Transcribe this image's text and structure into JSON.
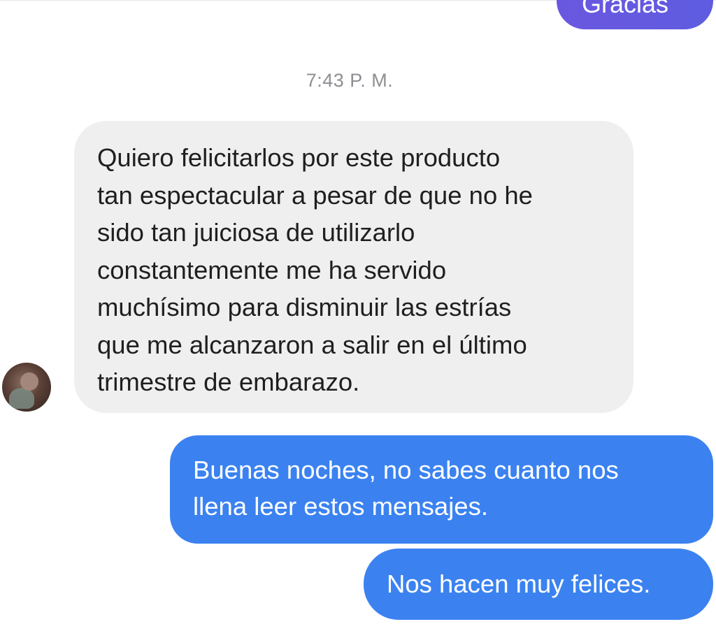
{
  "colors": {
    "background": "#ffffff",
    "incoming_bubble": "#efefef",
    "outgoing_bubble": "#3b82f0",
    "previous_outgoing_bubble": "#6a57e0",
    "timestamp_text": "#8e8e93"
  },
  "conversation": {
    "previous_outgoing": {
      "partial_text": "Gracias"
    },
    "timestamp": "7:43 P. M.",
    "incoming_message": {
      "avatar_icon": "user-avatar",
      "lines": [
        "Quiero felicitarlos por este producto",
        "tan espectacular a pesar de que no he",
        "sido tan juiciosa de utilizarlo",
        "constantemente me ha servido",
        "muchísimo para disminuir las estrías",
        "que me alcanzaron a salir en el último",
        "trimestre de embarazo."
      ]
    },
    "outgoing_messages": [
      {
        "lines": [
          "Buenas noches, no sabes cuanto nos",
          "llena leer estos mensajes."
        ]
      },
      {
        "lines": [
          "Nos hacen muy felices."
        ]
      }
    ]
  }
}
